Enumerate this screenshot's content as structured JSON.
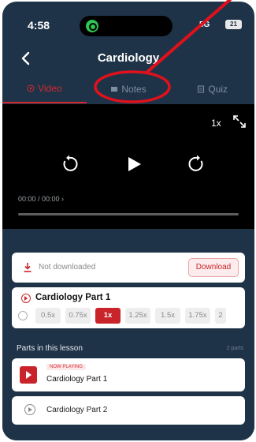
{
  "status": {
    "time": "4:58",
    "network": "5G",
    "battery": "21"
  },
  "header": {
    "title": "Cardiology"
  },
  "tabs": [
    {
      "label": "Video",
      "active": true
    },
    {
      "label": "Notes",
      "active": false
    },
    {
      "label": "Quiz",
      "active": false
    }
  ],
  "player": {
    "speed": "1x",
    "timecode": "00:00 / 00:00",
    "progress": 0
  },
  "download": {
    "status": "Not downloaded",
    "button": "Download"
  },
  "lesson": {
    "title": "Cardiology Part 1",
    "speeds": [
      "0.5x",
      "0.75x",
      "1x",
      "1.25x",
      "1.5x",
      "1.75x",
      "2"
    ],
    "selected_speed": "1x"
  },
  "parts": {
    "heading": "Parts in this lesson",
    "count": "2 parts",
    "items": [
      {
        "badge": "NOW PLAYING",
        "title": "Cardiology Part 1"
      },
      {
        "badge": "",
        "title": "Cardiology Part 2"
      }
    ]
  },
  "colors": {
    "accent": "#c9242a",
    "navy": "#1f3348",
    "annotation": "#e0111b"
  }
}
